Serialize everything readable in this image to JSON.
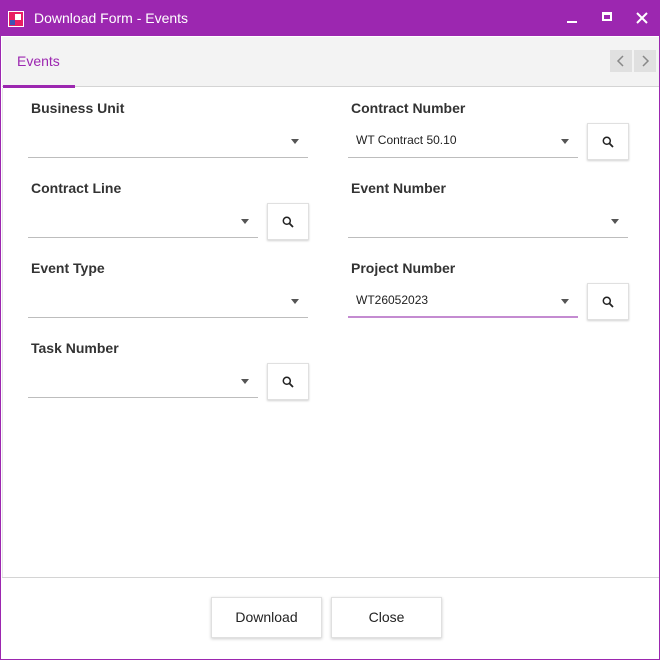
{
  "window": {
    "title": "Download Form - Events",
    "accent_color": "#9c27b0"
  },
  "tabs": [
    {
      "label": "Events",
      "active": true
    }
  ],
  "fields": {
    "business_unit": {
      "label": "Business Unit",
      "value": ""
    },
    "contract_number": {
      "label": "Contract Number",
      "value": "WT Contract 50.10"
    },
    "contract_line": {
      "label": "Contract Line",
      "value": ""
    },
    "event_number": {
      "label": "Event Number",
      "value": ""
    },
    "event_type": {
      "label": "Event Type",
      "value": ""
    },
    "project_number": {
      "label": "Project Number",
      "value": "WT26052023"
    },
    "task_number": {
      "label": "Task Number",
      "value": ""
    }
  },
  "buttons": {
    "download": "Download",
    "close": "Close"
  }
}
